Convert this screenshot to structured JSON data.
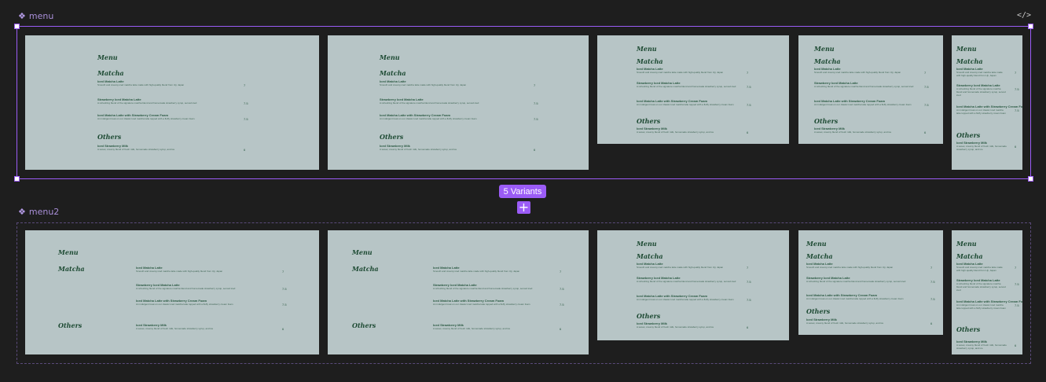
{
  "set1": {
    "name": "menu"
  },
  "set2": {
    "name": "menu2"
  },
  "code_icon": "</>",
  "variants_badge": "5 Variants",
  "add_icon": "+",
  "menu": {
    "title": "Menu",
    "matcha": "Matcha",
    "others": "Others",
    "items": [
      {
        "name": "Iced Matcha Latte",
        "desc": "Smooth and creamy iced matcha latte made with high-quality blend from Uji, Japan",
        "price": "7"
      },
      {
        "name": "Strawberry Iced Matcha Latte",
        "desc": "A refreshing blend of the signature matcha blend and homemade strawberry syrup, served iced",
        "price": "7.5"
      },
      {
        "name": "Iced Matcha Latte with Strawberry Cream Foam",
        "desc": "An indulgent treat on our classic iced matcha latte topped with a fluffy strawberry cream foam",
        "price": "7.5"
      },
      {
        "name": "Iced Strawberry Milk",
        "desc": "A sweet, creamy blend of fresh milk, homemade strawberry syrup, and ice",
        "price": "6"
      }
    ]
  }
}
